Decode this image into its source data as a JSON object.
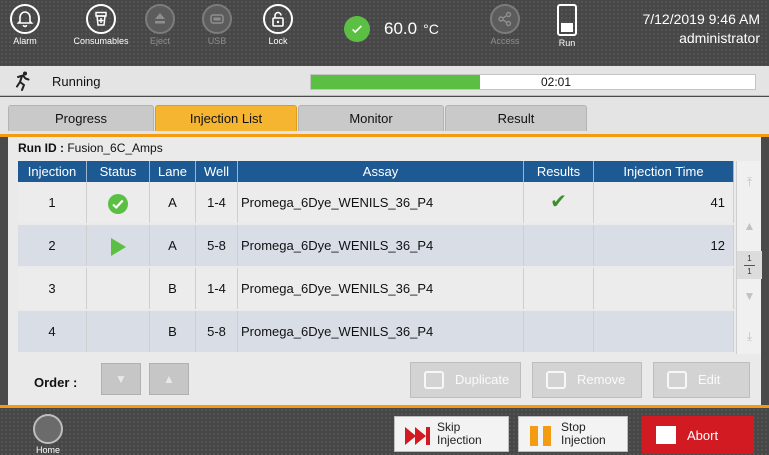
{
  "topbar": {
    "buttons": [
      {
        "label": "Alarm",
        "icon": "bell-icon",
        "enabled": true
      },
      {
        "label": "Consumables",
        "icon": "consumables-icon",
        "enabled": true
      },
      {
        "label": "Eject",
        "icon": "eject-icon",
        "enabled": false
      },
      {
        "label": "USB",
        "icon": "usb-icon",
        "enabled": false
      },
      {
        "label": "Lock",
        "icon": "lock-icon",
        "enabled": true
      },
      {
        "label": "Access",
        "icon": "share-icon",
        "enabled": false
      },
      {
        "label": "Run",
        "icon": "run-icon",
        "enabled": true
      }
    ],
    "temperature": {
      "value": "60.0",
      "unit": "°C",
      "status_color": "#5bbf44"
    },
    "date_time": "7/12/2019 9:46 AM",
    "user": "administrator"
  },
  "status": {
    "label": "Running",
    "time": "02:01",
    "progress_percent": 38,
    "progress_color": "#5bbf44"
  },
  "tabs": [
    {
      "label": "Progress",
      "active": false
    },
    {
      "label": "Injection List",
      "active": true
    },
    {
      "label": "Monitor",
      "active": false
    },
    {
      "label": "Result",
      "active": false
    }
  ],
  "run_id": {
    "label": "Run ID :",
    "value": "Fusion_6C_Amps"
  },
  "table": {
    "columns": [
      "Injection",
      "Status",
      "Lane",
      "Well",
      "Assay",
      "Results",
      "Injection Time"
    ],
    "rows": [
      {
        "injection": "1",
        "status": "complete",
        "lane": "A",
        "well": "1-4",
        "assay": "Promega_6Dye_WENILS_36_P4",
        "results": "check",
        "injection_time": "41"
      },
      {
        "injection": "2",
        "status": "running",
        "lane": "A",
        "well": "5-8",
        "assay": "Promega_6Dye_WENILS_36_P4",
        "results": "",
        "injection_time": "12"
      },
      {
        "injection": "3",
        "status": "",
        "lane": "B",
        "well": "1-4",
        "assay": "Promega_6Dye_WENILS_36_P4",
        "results": "",
        "injection_time": ""
      },
      {
        "injection": "4",
        "status": "",
        "lane": "B",
        "well": "5-8",
        "assay": "Promega_6Dye_WENILS_36_P4",
        "results": "",
        "injection_time": ""
      }
    ],
    "page": {
      "current": "1",
      "total": "1"
    }
  },
  "order": {
    "label": "Order :"
  },
  "actions": {
    "duplicate": "Duplicate",
    "remove": "Remove",
    "edit": "Edit"
  },
  "footer": {
    "home": "Home",
    "skip": {
      "line1": "Skip",
      "line2": "Injection"
    },
    "stop": {
      "line1": "Stop",
      "line2": "Injection"
    },
    "abort": "Abort",
    "accent_color": "#f39c12",
    "abort_color": "#d11a22"
  }
}
